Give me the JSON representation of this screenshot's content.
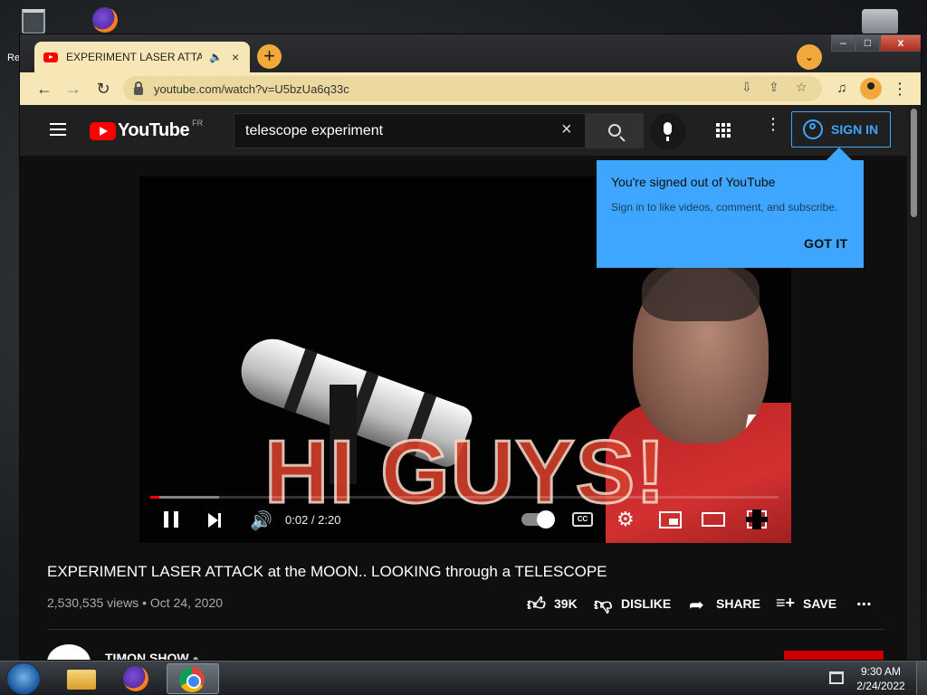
{
  "desktop": {
    "recycle_label": "Re"
  },
  "browser": {
    "tab": {
      "title": "EXPERIMENT LASER ATTACK",
      "audio_icon": "speaker-icon",
      "close": "×"
    },
    "new_tab": "+",
    "tab_search": "⌄",
    "window_controls": {
      "minimize": "–",
      "maximize": "□",
      "close": "x"
    },
    "nav": {
      "back": "←",
      "forward": "→",
      "reload": "↻"
    },
    "address": "youtube.com/watch?v=U5bzUa6q33c",
    "menu": "⋮"
  },
  "youtube": {
    "logo_text": "YouTube",
    "country_code": "FR",
    "search": {
      "value": "telescope experiment",
      "clear": "×"
    },
    "more": "⋮",
    "signin_label": "SIGN IN",
    "popup": {
      "title": "You're signed out of YouTube",
      "subtitle": "Sign in to like videos, comment, and subscribe.",
      "button": "GOT IT"
    },
    "player": {
      "overlay_text": "HI GUYS!",
      "time": "0:02 / 2:20",
      "progress_fraction": 0.014,
      "buffered_fraction": 0.11,
      "cc": "CC"
    },
    "video": {
      "title": "EXPERIMENT LASER ATTACK at the MOON.. LOOKING through a TELESCOPE",
      "views": "2,530,535 views • Oct 24, 2020",
      "actions": {
        "like": "39K",
        "dislike": "DISLIKE",
        "share": "SHARE",
        "save": "SAVE",
        "more": "..."
      }
    },
    "channel": {
      "name": "TIMON SHOW"
    }
  },
  "taskbar": {
    "time": "9:30 AM",
    "date": "2/24/2022"
  },
  "colors": {
    "accent": "#3ea6ff",
    "youtube_red": "#ff0000",
    "browser_theme": "#f7e7b6"
  }
}
